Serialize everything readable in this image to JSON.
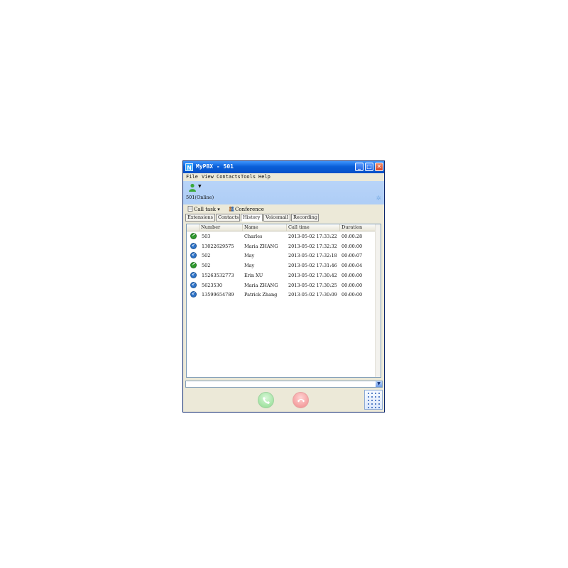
{
  "window": {
    "app_icon": "N",
    "title": "MyPBX - 501",
    "controls": {
      "minimize": "_",
      "maximize": "□",
      "close": "✕"
    }
  },
  "menu": [
    "File",
    "View",
    "Contacts",
    "Tools",
    "Help"
  ],
  "status": {
    "text": "501(Online)",
    "icon": "user-icon"
  },
  "toolbar": {
    "call_task": "Call task",
    "conference": "Conference"
  },
  "tabs": [
    "Extensions",
    "Contacts",
    "History",
    "Voicemail",
    "Recording"
  ],
  "active_tab": "History",
  "columns": [
    "Number",
    "Name",
    "Call time",
    "Duration"
  ],
  "rows": [
    {
      "type": "outgoing",
      "number": "503",
      "name": "Charles",
      "time": "2013-05-02 17:33:22",
      "duration": "00:00:28"
    },
    {
      "type": "incoming",
      "number": "13022629575",
      "name": "Maria ZHANG",
      "time": "2013-05-02 17:32:32",
      "duration": "00:00:00"
    },
    {
      "type": "incoming",
      "number": "502",
      "name": "May",
      "time": "2013-05-02 17:32:18",
      "duration": "00:00:07"
    },
    {
      "type": "outgoing",
      "number": "502",
      "name": "May",
      "time": "2013-05-02 17:31:46",
      "duration": "00:00:04"
    },
    {
      "type": "incoming",
      "number": "15263532773",
      "name": "Erin XU",
      "time": "2013-05-02 17:30:42",
      "duration": "00:00:00"
    },
    {
      "type": "incoming",
      "number": "5623530",
      "name": "Maria ZHANG",
      "time": "2013-05-02 17:30:25",
      "duration": "00:00:00"
    },
    {
      "type": "incoming",
      "number": "13599654789",
      "name": "Patrick Zhang",
      "time": "2013-05-02 17:30:09",
      "duration": "00:00:00"
    }
  ],
  "colors": {
    "outgoing": "#2e9a2e",
    "incoming": "#2f74c9",
    "title_bar": "#0a5fd8",
    "status_band": "#b8d4f8"
  }
}
